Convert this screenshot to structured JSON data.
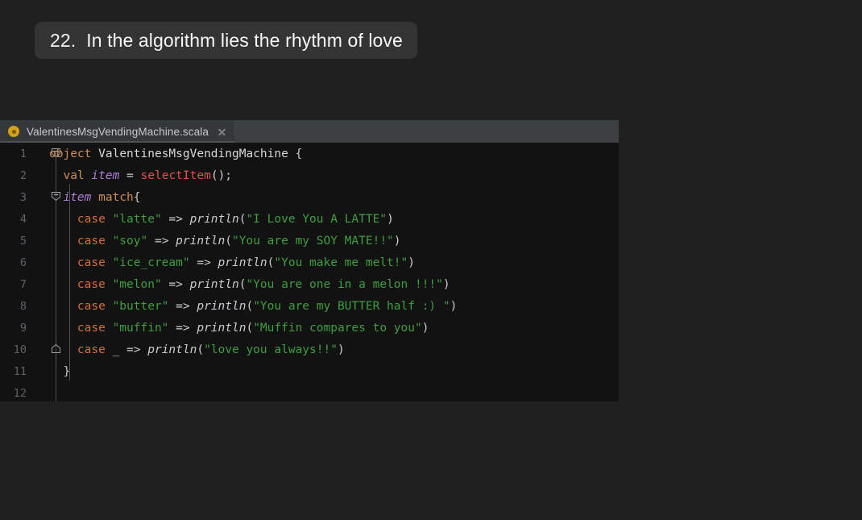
{
  "title_chip": {
    "number": "22.",
    "text": "In the algorithm lies the rhythm of love"
  },
  "editor": {
    "tab": {
      "filename": "ValentinesMsgVendingMachine.scala",
      "icon": "scala-object-icon",
      "close_icon": "close-icon"
    },
    "language": "scala",
    "code_lines": [
      {
        "n": "1",
        "text": "object ValentinesMsgVendingMachine {"
      },
      {
        "n": "2",
        "text": "  val item = selectItem();"
      },
      {
        "n": "3",
        "text": "  item match{"
      },
      {
        "n": "4",
        "text": "    case \"latte\" => println(\"I Love You A LATTE\")"
      },
      {
        "n": "5",
        "text": "    case \"soy\" => println(\"You are my SOY MATE!!\")"
      },
      {
        "n": "6",
        "text": "    case \"ice_cream\" => println(\"You make me melt!\")"
      },
      {
        "n": "7",
        "text": "    case \"melon\" => println(\"You are one in a melon !!!\")"
      },
      {
        "n": "8",
        "text": "    case \"butter\" => println(\"You are my BUTTER half :) \")"
      },
      {
        "n": "9",
        "text": "    case \"muffin\" => println(\"Muffin compares to you\")"
      },
      {
        "n": "10",
        "text": "    case _ => println(\"love you always!!\")"
      },
      {
        "n": "11",
        "text": "  }"
      },
      {
        "n": "12",
        "text": ""
      }
    ],
    "fold_markers": [
      {
        "line": "1",
        "state": "expanded"
      },
      {
        "line": "3",
        "state": "expanded"
      },
      {
        "line": "11",
        "state": "fold-end"
      }
    ]
  },
  "colors": {
    "page_background": "#202020",
    "chip_background": "#343434",
    "tab_bar": "#3c4043",
    "active_tab": "#35383b",
    "code_background": "#121212",
    "line_number": "#5e6468",
    "keyword": "#cf8e52",
    "keyword_case": "#d2703a",
    "string": "#3f9e40",
    "variable": "#b07fd8",
    "function": "#e05252",
    "punctuation": "#c9ccd0",
    "scala_icon": "#d4a017"
  }
}
